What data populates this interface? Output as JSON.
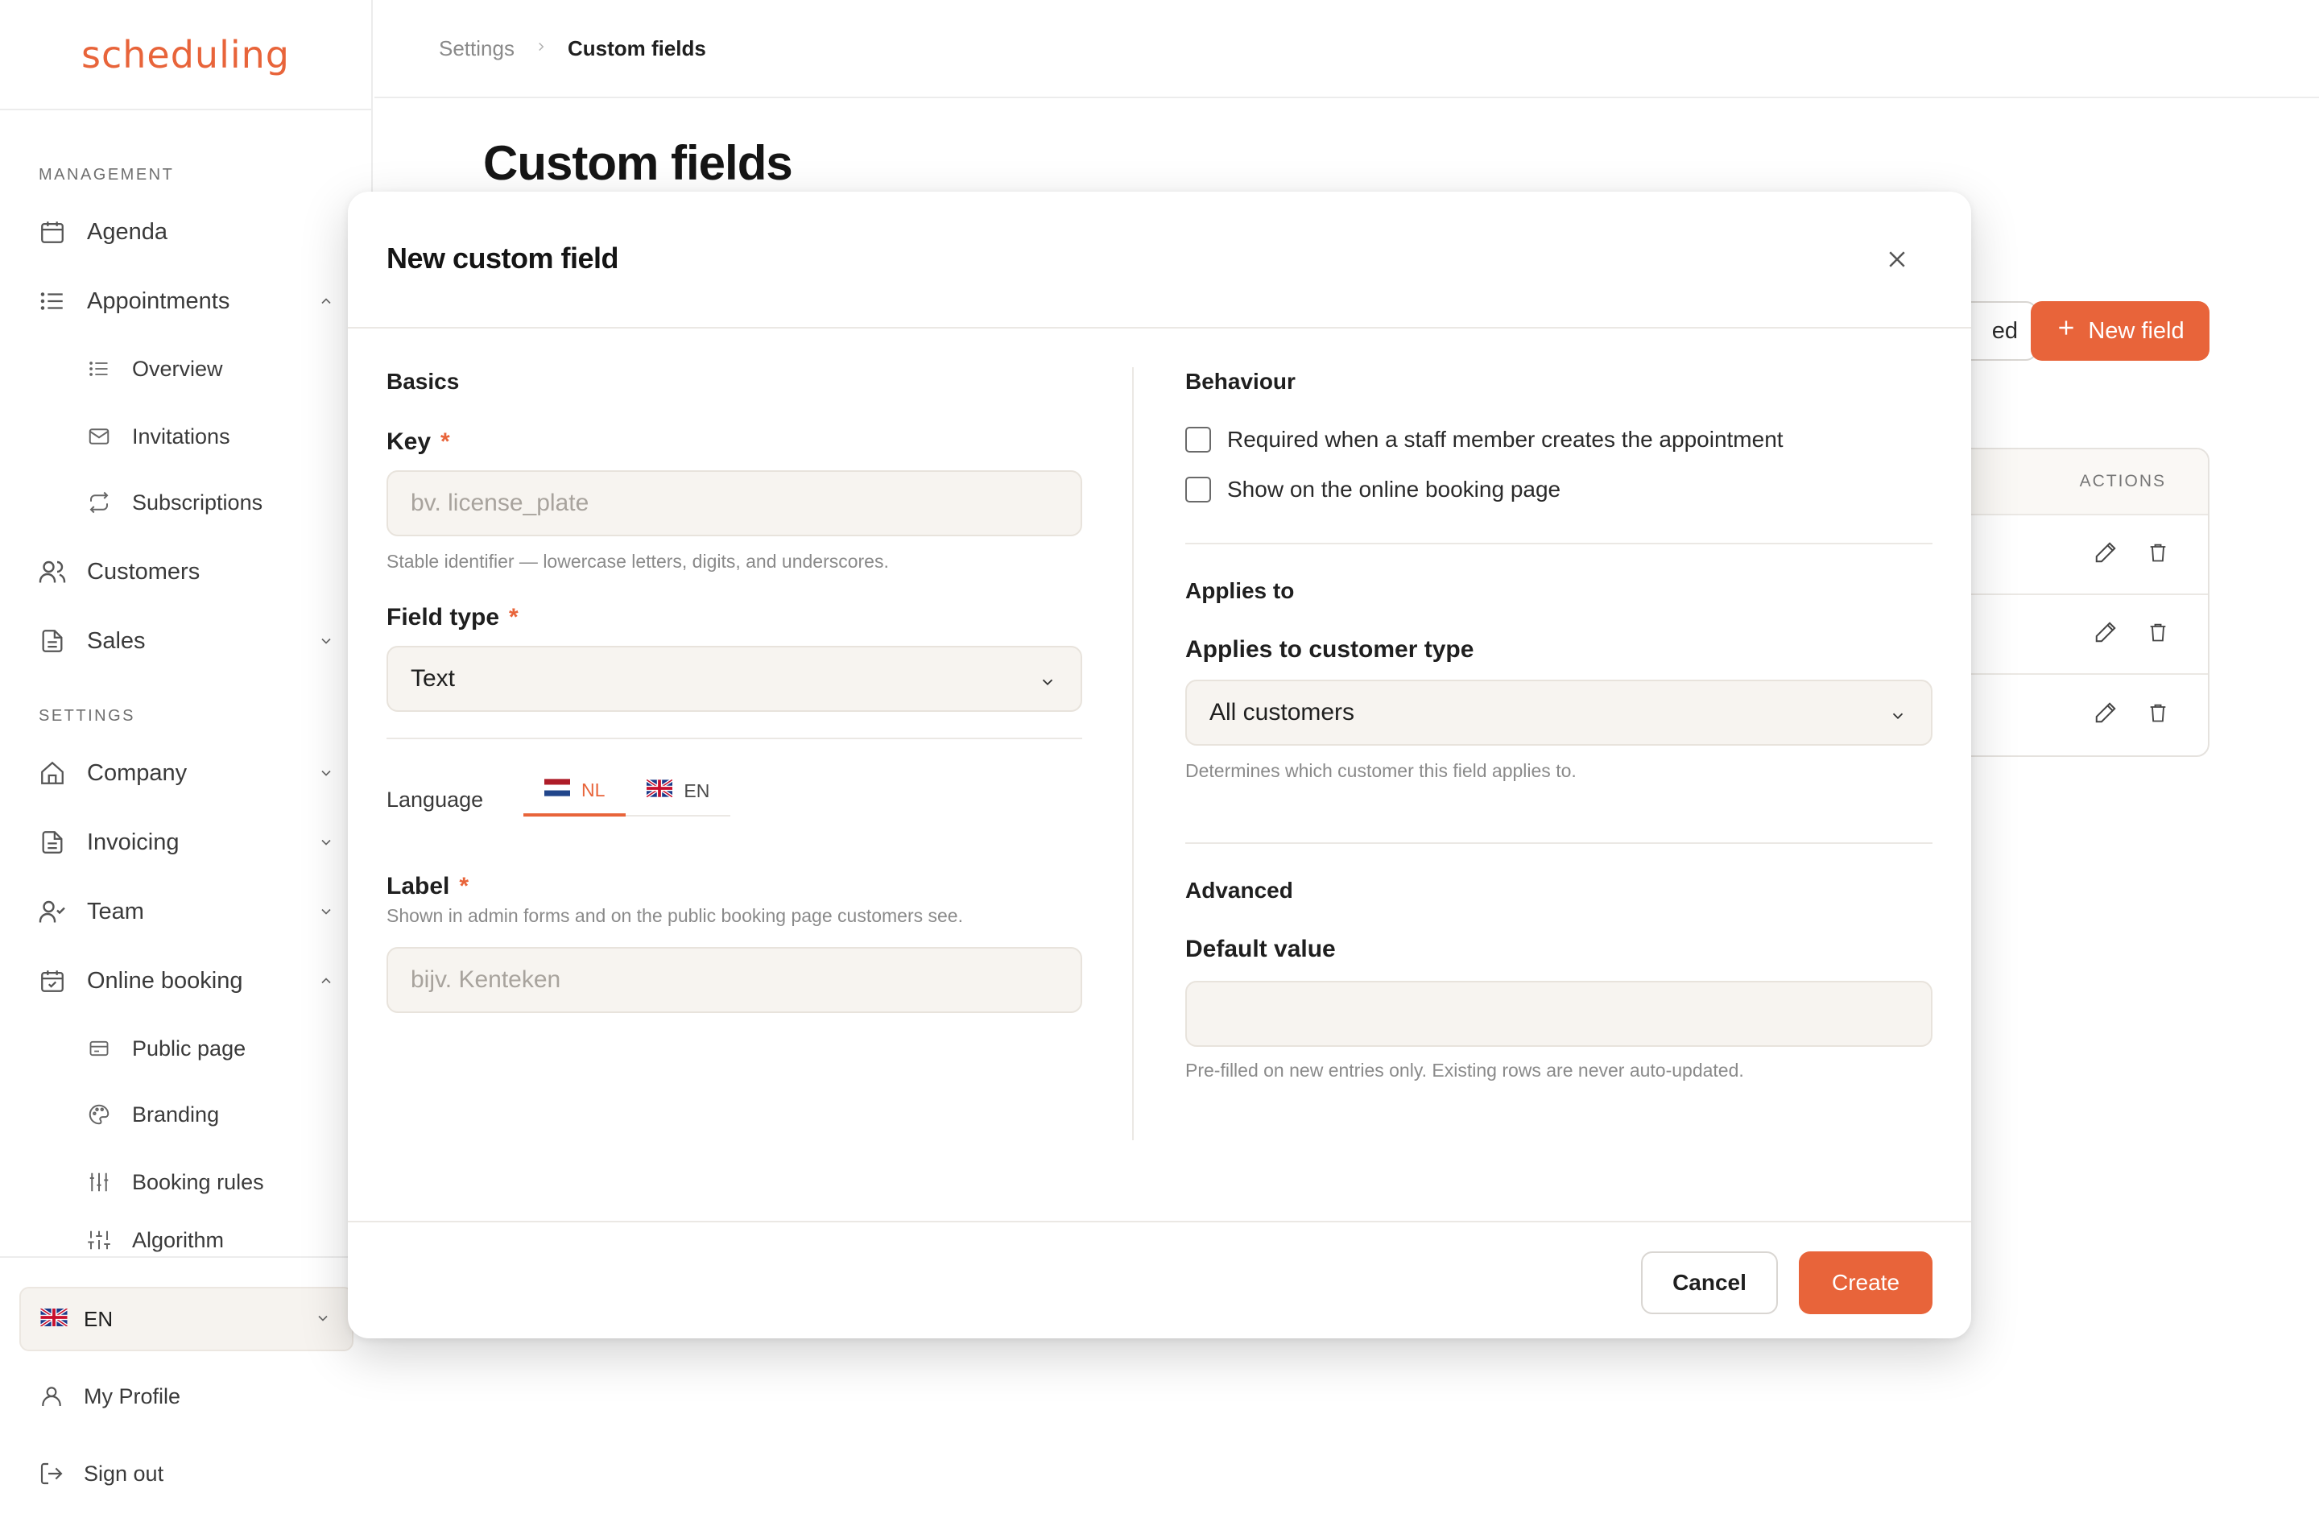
{
  "app": {
    "logo": "scheduling",
    "accent": "#e8643a"
  },
  "breadcrumb": {
    "parent": "Settings",
    "current": "Custom fields"
  },
  "page": {
    "title": "Custom fields",
    "ghost_button_label": "ed",
    "new_field_label": "New field",
    "actions_header": "ACTIONS"
  },
  "sidebar": {
    "management_title": "MANAGEMENT",
    "settings_title": "SETTINGS",
    "agenda": "Agenda",
    "appointments": "Appointments",
    "overview": "Overview",
    "invitations": "Invitations",
    "subscriptions": "Subscriptions",
    "customers": "Customers",
    "sales": "Sales",
    "company": "Company",
    "invoicing": "Invoicing",
    "team": "Team",
    "online_booking": "Online booking",
    "public_page": "Public page",
    "branding": "Branding",
    "booking_rules": "Booking rules",
    "algorithm": "Algorithm",
    "language": "EN",
    "my_profile": "My Profile",
    "sign_out": "Sign out"
  },
  "modal": {
    "title": "New custom field",
    "basics": {
      "title": "Basics",
      "key_label": "Key",
      "key_required": "*",
      "key_placeholder": "bv. license_plate",
      "key_hint": "Stable identifier — lowercase letters, digits, and underscores.",
      "type_label": "Field type",
      "type_required": "*",
      "type_value": "Text",
      "language_label": "Language",
      "tab_nl": "NL",
      "tab_en": "EN",
      "label_label": "Label",
      "label_required": "*",
      "label_hint": "Shown in admin forms and on the public booking page customers see.",
      "label_placeholder": "bijv. Kenteken"
    },
    "behaviour": {
      "title": "Behaviour",
      "required_staff": "Required when a staff member creates the appointment",
      "show_online": "Show on the online booking page"
    },
    "applies": {
      "title": "Applies to",
      "customer_type_label": "Applies to customer type",
      "customer_type_value": "All customers",
      "hint": "Determines which customer this field applies to."
    },
    "advanced": {
      "title": "Advanced",
      "default_label": "Default value",
      "default_value": "",
      "hint": "Pre-filled on new entries only. Existing rows are never auto-updated."
    },
    "cancel": "Cancel",
    "create": "Create"
  }
}
